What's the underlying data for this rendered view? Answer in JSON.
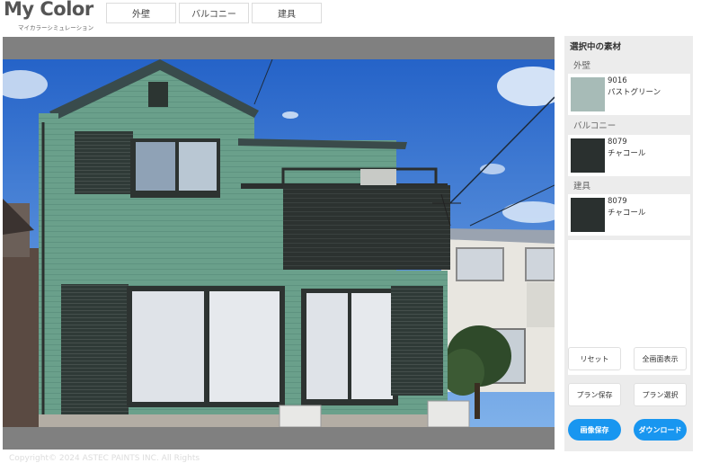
{
  "logo": {
    "main": "My Color",
    "sub": "マイカラーシミュレーション"
  },
  "tabs": [
    {
      "label": "外壁"
    },
    {
      "label": "バルコニー"
    },
    {
      "label": "建具"
    }
  ],
  "sidebar": {
    "title": "選択中の素材",
    "categories": [
      {
        "label": "外壁",
        "code": "9016",
        "name": "パストグリーン",
        "color": "#a7bbb7"
      },
      {
        "label": "バルコニー",
        "code": "8079",
        "name": "チャコール",
        "color": "#2a302f"
      },
      {
        "label": "建具",
        "code": "8079",
        "name": "チャコール",
        "color": "#2a302f"
      }
    ],
    "buttons": {
      "reset": "リセット",
      "fullscreen": "全画面表示",
      "plan_save": "プラン保存",
      "plan_select": "プラン選択",
      "image_save": "画像保存",
      "download": "ダウンロード"
    },
    "accent_color": "#1896f0"
  },
  "footer": {
    "copyright": "Copyright© 2024 ASTEC PAINTS INC. All Rights"
  }
}
